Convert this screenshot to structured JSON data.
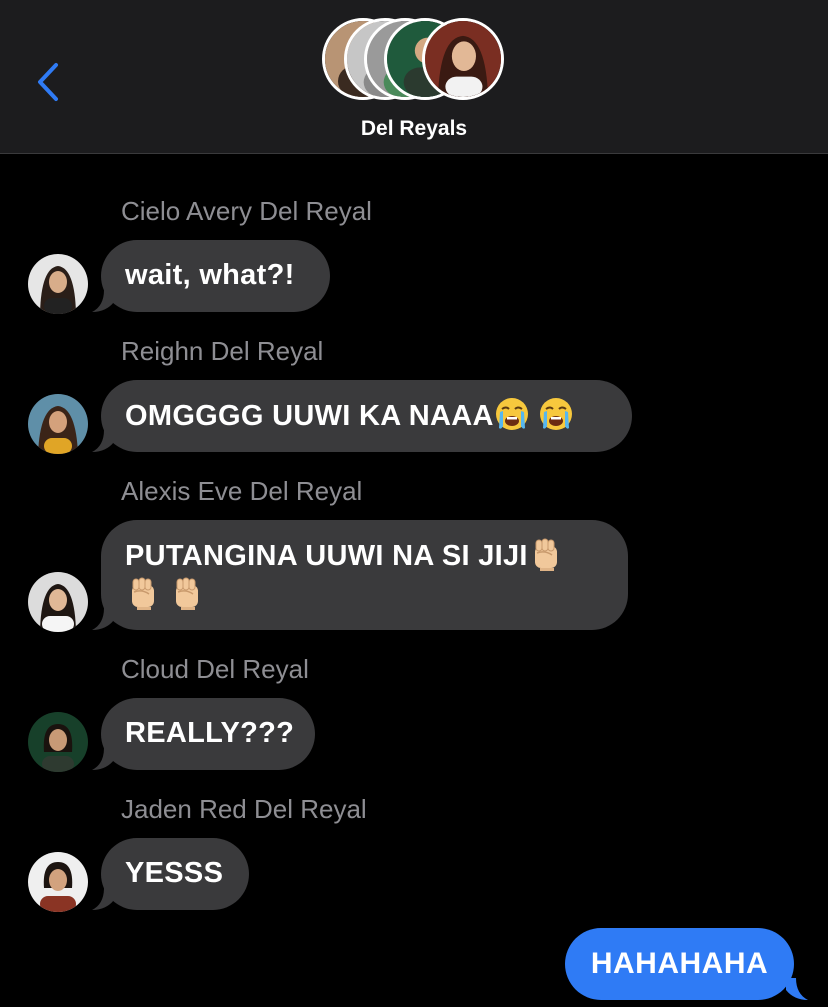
{
  "header": {
    "group_name": "Del Reyals",
    "back_icon": "chevron-left-icon",
    "accent": "#2f7bf5"
  },
  "messages": [
    {
      "sender": "Cielo Avery Del Reyal",
      "text": "wait, what?!"
    },
    {
      "sender": "Reighn Del Reyal",
      "text": "OMGGGG UUWI KA NAAA",
      "emoji": [
        "loudly-crying-face-icon",
        "loudly-crying-face-icon"
      ]
    },
    {
      "sender": "Alexis Eve Del Reyal",
      "text": "PUTANGINA UUWI NA SI JIJI",
      "emoji": [
        "raised-fist-icon",
        "raised-fist-icon",
        "raised-fist-icon"
      ]
    },
    {
      "sender": "Cloud Del Reyal",
      "text": "REALLY???"
    },
    {
      "sender": "Jaden Red Del Reyal",
      "text": "YESSS"
    }
  ],
  "outgoing": {
    "text": "HAHAHAHA"
  },
  "colors": {
    "background": "#000000",
    "header": "#1c1c1e",
    "incoming_bubble": "#3a3a3c",
    "outgoing_bubble": "#2f7bf5",
    "sender_label": "#8e8e93"
  }
}
